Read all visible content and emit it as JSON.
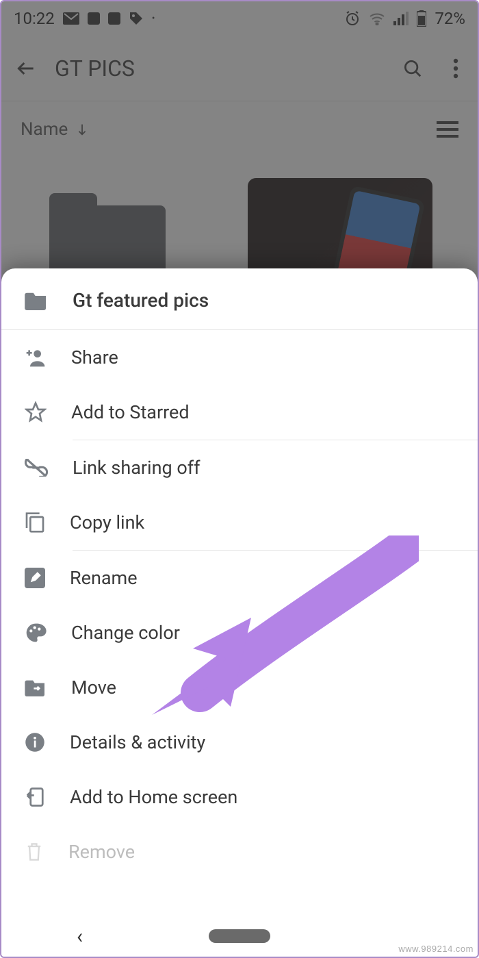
{
  "status": {
    "time": "10:22",
    "battery_pct": "72%"
  },
  "appbar": {
    "title": "GT PICS"
  },
  "sort": {
    "label": "Name"
  },
  "sheet": {
    "title": "Gt featured pics",
    "items": {
      "share": "Share",
      "starred": "Add to Starred",
      "link_off": "Link sharing off",
      "copy_link": "Copy link",
      "rename": "Rename",
      "change_color": "Change color",
      "move": "Move",
      "details": "Details & activity",
      "add_home": "Add to Home screen",
      "remove": "Remove"
    }
  },
  "watermark": "www.989214.com"
}
